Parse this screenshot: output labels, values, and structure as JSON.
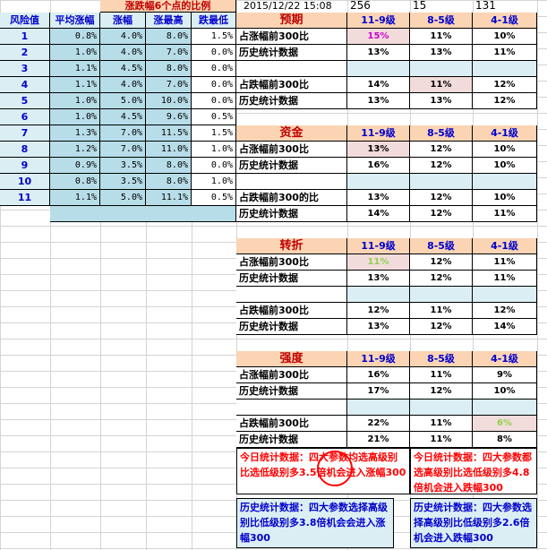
{
  "top_bar": {
    "title": "涨跌幅6个点的比例",
    "timestamp": "2015/12/22 15:08",
    "v1": "256",
    "v2": "15",
    "v3": "131"
  },
  "left_table": {
    "headers": [
      "风险值",
      "平均涨幅",
      "涨幅",
      "涨最高",
      "跌最低"
    ],
    "rows": [
      [
        "1",
        "0.8%",
        "4.0%",
        "8.0%",
        "1.5%"
      ],
      [
        "2",
        "1.0%",
        "4.0%",
        "7.0%",
        "0.0%"
      ],
      [
        "3",
        "1.1%",
        "4.5%",
        "8.0%",
        "0.0%"
      ],
      [
        "4",
        "1.1%",
        "4.0%",
        "7.0%",
        "0.0%"
      ],
      [
        "5",
        "1.0%",
        "5.0%",
        "10.0%",
        "0.0%"
      ],
      [
        "6",
        "1.0%",
        "4.5%",
        "9.6%",
        "0.5%"
      ],
      [
        "7",
        "1.3%",
        "7.0%",
        "11.5%",
        "1.5%"
      ],
      [
        "8",
        "1.2%",
        "7.0%",
        "11.0%",
        "1.0%"
      ],
      [
        "9",
        "0.9%",
        "3.5%",
        "8.0%",
        "0.0%"
      ],
      [
        "10",
        "0.8%",
        "3.5%",
        "8.0%",
        "1.0%"
      ],
      [
        "11",
        "1.1%",
        "5.0%",
        "11.1%",
        "0.5%"
      ]
    ]
  },
  "levels": [
    "11-9级",
    "8-5级",
    "4-1级"
  ],
  "sections": [
    {
      "name": "预期",
      "rows": [
        {
          "label": "占涨幅前300比",
          "vals": [
            "15%",
            "11%",
            "10%"
          ]
        },
        {
          "label": "历史统计数据",
          "vals": [
            "13%",
            "13%",
            "11%"
          ]
        },
        {
          "label": "",
          "vals": [
            "",
            "",
            ""
          ]
        },
        {
          "label": "占跌幅前300比",
          "vals": [
            "14%",
            "11%",
            "12%"
          ]
        },
        {
          "label": "历史统计数据",
          "vals": [
            "13%",
            "13%",
            "12%"
          ]
        }
      ]
    },
    {
      "name": "资金",
      "rows": [
        {
          "label": "占涨幅前300比",
          "vals": [
            "13%",
            "12%",
            "10%"
          ]
        },
        {
          "label": "历史统计数据",
          "vals": [
            "16%",
            "12%",
            "10%"
          ]
        },
        {
          "label": "",
          "vals": [
            "",
            "",
            ""
          ]
        },
        {
          "label": "占跌幅前300的比",
          "vals": [
            "13%",
            "12%",
            "10%"
          ]
        },
        {
          "label": "历史统计数据",
          "vals": [
            "14%",
            "12%",
            "11%"
          ]
        }
      ]
    },
    {
      "name": "转折",
      "rows": [
        {
          "label": "占涨幅前300比",
          "vals": [
            "11%",
            "12%",
            "11%"
          ]
        },
        {
          "label": "历史统计数据",
          "vals": [
            "13%",
            "12%",
            "11%"
          ]
        },
        {
          "label": "",
          "vals": [
            "",
            "",
            ""
          ]
        },
        {
          "label": "占跌幅前300比",
          "vals": [
            "12%",
            "11%",
            "12%"
          ]
        },
        {
          "label": "历史统计数据",
          "vals": [
            "13%",
            "12%",
            "14%"
          ]
        }
      ]
    },
    {
      "name": "强度",
      "rows": [
        {
          "label": "占涨幅前300比",
          "vals": [
            "16%",
            "11%",
            "9%"
          ]
        },
        {
          "label": "历史统计数据",
          "vals": [
            "17%",
            "12%",
            "10%"
          ]
        },
        {
          "label": "",
          "vals": [
            "",
            "",
            ""
          ]
        },
        {
          "label": "占跌幅前300比",
          "vals": [
            "22%",
            "11%",
            "6%"
          ]
        },
        {
          "label": "历史统计数据",
          "vals": [
            "21%",
            "11%",
            "8%"
          ]
        }
      ]
    }
  ],
  "notes": {
    "today_up": "今日统计数据：四大参数均选高级别比选低级别多3.5倍机会进入涨幅300",
    "today_down": "今日统计数据：四大参数都选高级别比选低级别多4.8倍机会进入跌幅300",
    "hist_up": "历史统计数据：四大参数选择高级别比低级别多3.8倍机会会进入涨幅300",
    "hist_down": "历史统计数据：四大参数选择高级别比低级别多2.6倍机会进入跌幅300"
  },
  "colors": {
    "header_bg": "#fbd4b4",
    "light_blue": "#dbeef3",
    "mid_blue": "#b7dde8",
    "header_text": "#0000cc",
    "section_text": "#c00000",
    "highlight_pink": "#f2dcdb",
    "green_text": "#92d050",
    "magenta_text": "#cc00cc",
    "note_red": "#ff0000",
    "note_blue": "#0000cc"
  }
}
